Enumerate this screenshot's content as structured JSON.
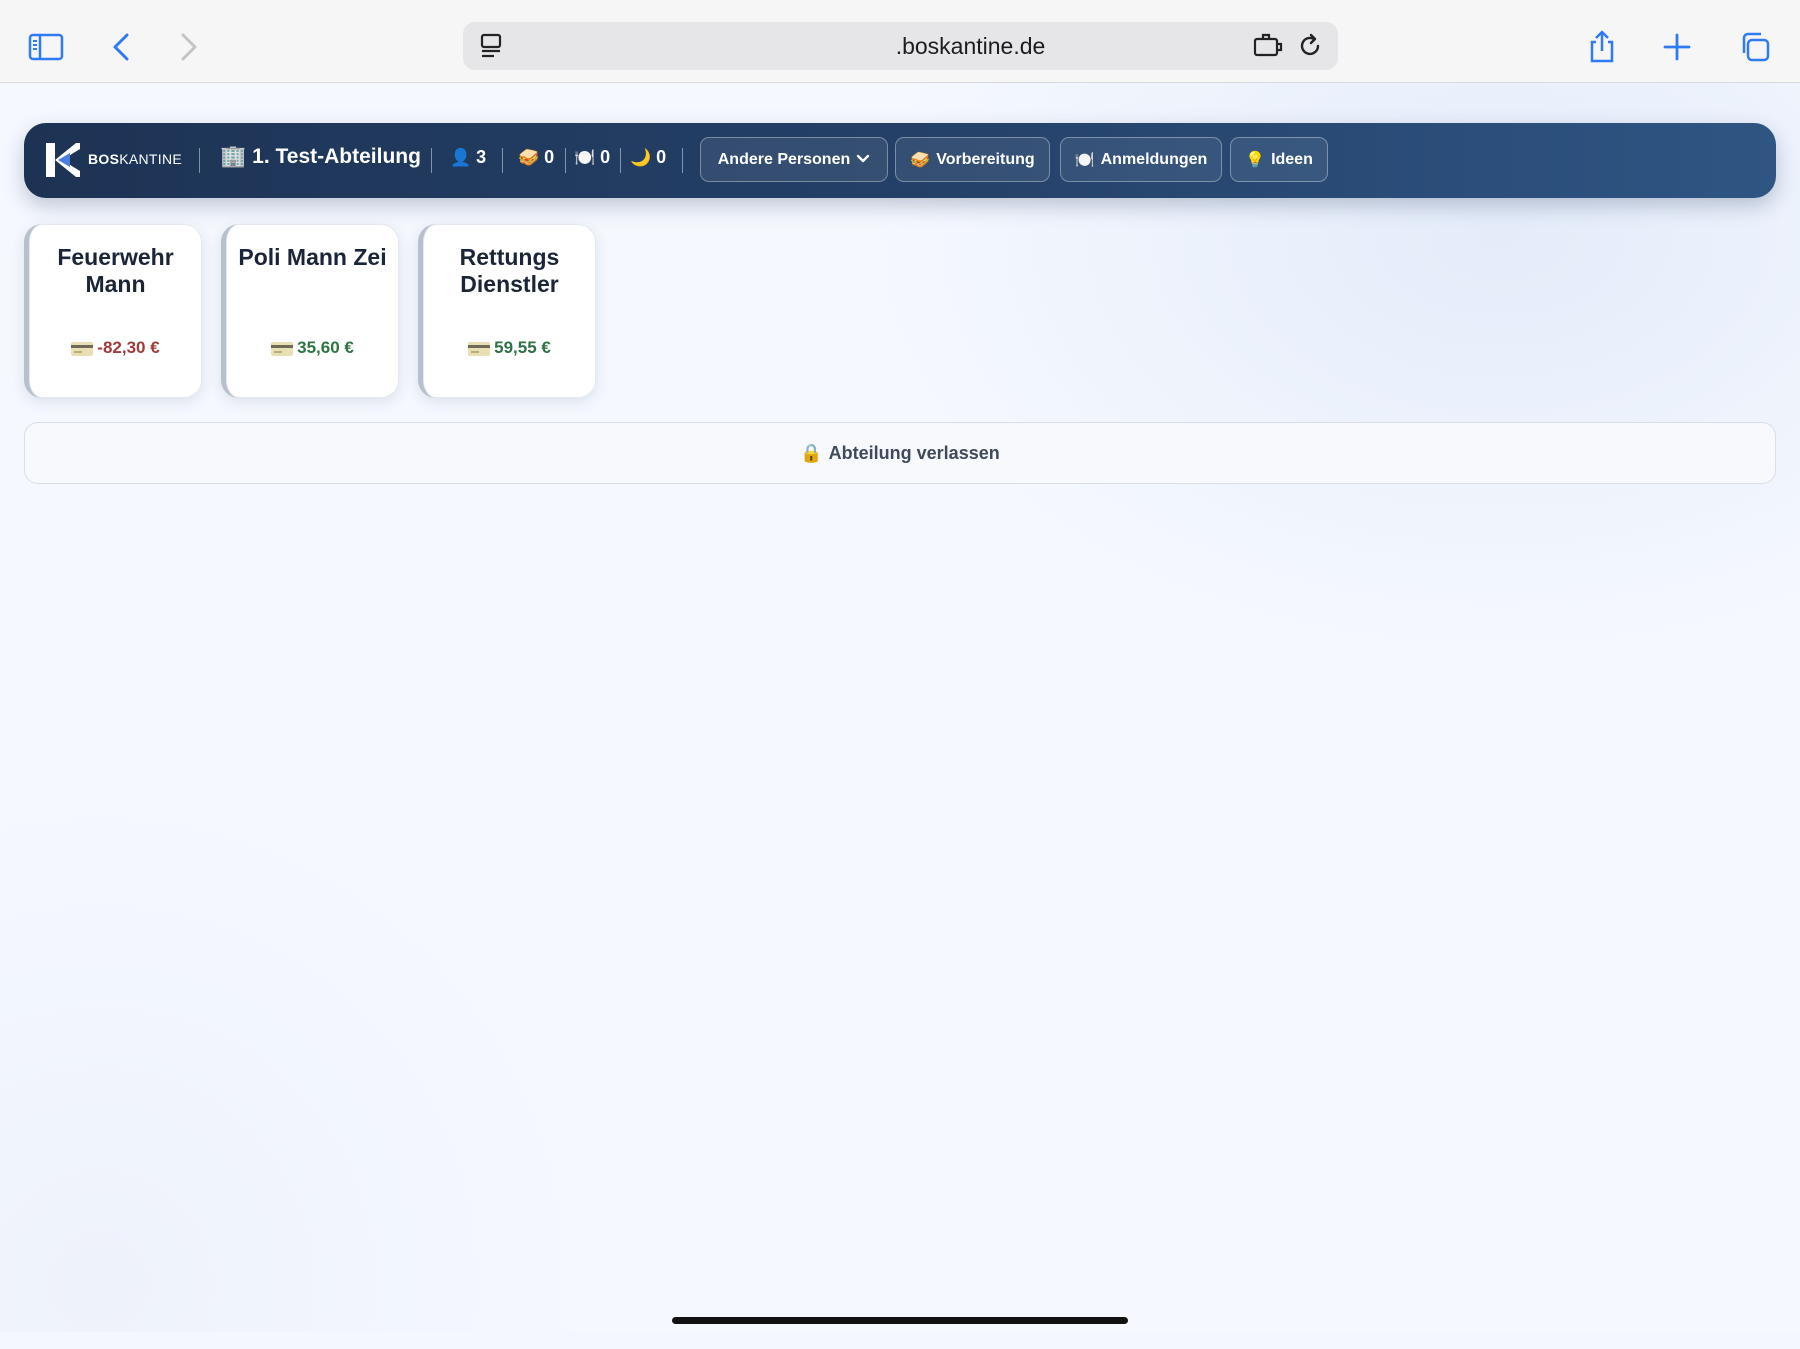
{
  "browser": {
    "url": ".boskantine.de",
    "icons": [
      "sidebar-icon",
      "back-icon",
      "forward-icon",
      "reader-icon",
      "extension-icon",
      "reload-icon",
      "share-icon",
      "new-tab-icon",
      "tabs-icon"
    ],
    "accent": "#2f7bf6"
  },
  "nav": {
    "brand_bold": "BOS",
    "brand_rest": "KANTINE",
    "department_emoji": "🏢",
    "department": "1. Test-Abteilung",
    "stats": [
      {
        "emoji": "👤",
        "value": "3"
      },
      {
        "emoji": "🥪",
        "value": "0"
      },
      {
        "emoji": "🍽️",
        "value": "0"
      },
      {
        "emoji": "🌙",
        "value": "0"
      }
    ],
    "buttons": {
      "others": "Andere Personen",
      "preparation_emoji": "🥪",
      "preparation": "Vorbereitung",
      "registrations_emoji": "🍽️",
      "registrations": "Anmeldungen",
      "ideas_emoji": "💡",
      "ideas": "Ideen"
    },
    "colors": {
      "from": "#1d3354",
      "to": "#2f5583"
    }
  },
  "persons": [
    {
      "name": "Feuerwehr Mann",
      "balance": "-82,30 €",
      "status": "negative"
    },
    {
      "name": "Poli Mann Zei",
      "balance": "35,60 €",
      "status": "positive"
    },
    {
      "name": "Rettungs Dienstler",
      "balance": "59,55 €",
      "status": "positive"
    }
  ],
  "leave": {
    "emoji": "🔒",
    "label": "Abteilung verlassen"
  },
  "colors": {
    "negative": "#9e3b3b",
    "positive": "#2f7245"
  }
}
